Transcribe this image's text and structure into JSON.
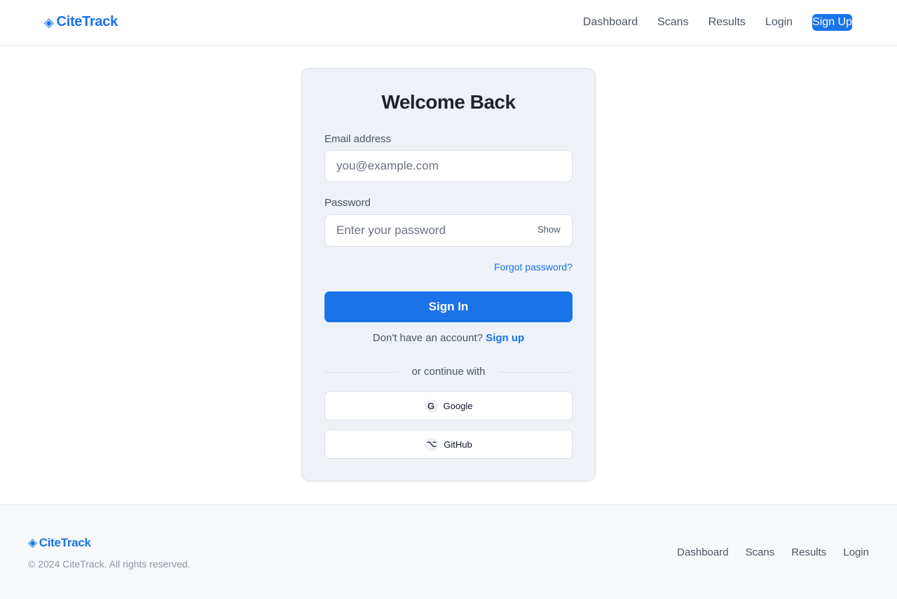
{
  "brand": {
    "name": "CiteTrack",
    "icon": "diamond-icon",
    "color": "#1a73e8"
  },
  "nav": {
    "items": [
      "Dashboard",
      "Scans",
      "Results",
      "Login"
    ],
    "signup": "Sign Up"
  },
  "login": {
    "title": "Welcome Back",
    "email_label": "Email address",
    "email_placeholder": "you@example.com",
    "email_value": "",
    "password_label": "Password",
    "password_placeholder": "Enter your password",
    "password_value": "",
    "show_label": "Show",
    "forgot_label": "Forgot password?",
    "submit_label": "Sign In",
    "no_account_text": "Don't have an account?",
    "signup_link": "Sign up",
    "divider_text": "or continue with",
    "social": [
      {
        "label": "Google",
        "icon": "google-icon",
        "glyph": "G"
      },
      {
        "label": "GitHub",
        "icon": "github-icon",
        "glyph": "⌥"
      }
    ]
  },
  "footer": {
    "brand": "CiteTrack",
    "copyright": "© 2024 CiteTrack. All rights reserved.",
    "links": [
      "Dashboard",
      "Scans",
      "Results",
      "Login"
    ]
  },
  "colors": {
    "primary": "#1a73e8",
    "card_bg": "#eef2f7",
    "footer_bg": "#f8f9fb"
  }
}
